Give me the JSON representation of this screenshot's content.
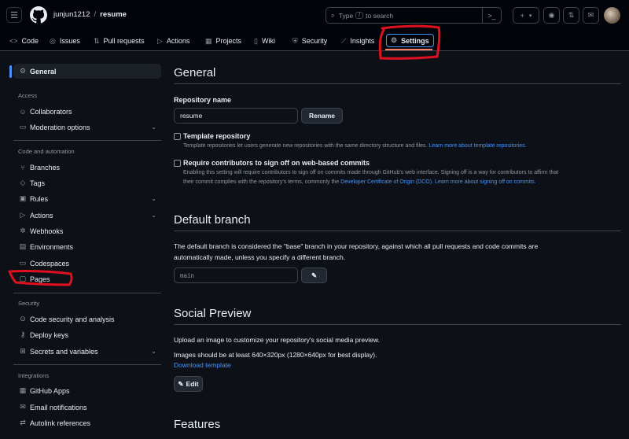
{
  "header": {
    "owner": "junjun1212",
    "separator": "/",
    "repo": "resume",
    "search_prefix": "Type",
    "search_key": "/",
    "search_suffix": "to search",
    "plus_label": "+",
    "icons": [
      "menu-icon",
      "github-logo",
      "search-icon",
      "command-palette-icon",
      "plus-icon",
      "issues-icon",
      "pull-requests-icon",
      "inbox-icon",
      "avatar"
    ]
  },
  "tabs": [
    {
      "label": "Code",
      "icon": "<>"
    },
    {
      "label": "Issues",
      "icon": "◎"
    },
    {
      "label": "Pull requests",
      "icon": "⇅"
    },
    {
      "label": "Actions",
      "icon": "▷"
    },
    {
      "label": "Projects",
      "icon": "▦"
    },
    {
      "label": "Wiki",
      "icon": "📖"
    },
    {
      "label": "Security",
      "icon": "⛨"
    },
    {
      "label": "Insights",
      "icon": "⟋"
    },
    {
      "label": "Settings",
      "icon": "⚙"
    }
  ],
  "sidebar": {
    "general": "General",
    "access_heading": "Access",
    "collaborators": "Collaborators",
    "moderation": "Moderation options",
    "code_heading": "Code and automation",
    "branches": "Branches",
    "tags": "Tags",
    "rules": "Rules",
    "actions": "Actions",
    "webhooks": "Webhooks",
    "environments": "Environments",
    "codespaces": "Codespaces",
    "pages": "Pages",
    "security_heading": "Security",
    "code_security": "Code security and analysis",
    "deploy_keys": "Deploy keys",
    "secrets": "Secrets and variables",
    "integrations_heading": "Integrations",
    "github_apps": "GitHub Apps",
    "email_notifications": "Email notifications",
    "autolink": "Autolink references"
  },
  "general": {
    "title": "General",
    "repo_name_label": "Repository name",
    "repo_name_value": "resume",
    "rename_button": "Rename",
    "template_label": "Template repository",
    "template_note": "Template repositories let users generate new repositories with the same directory structure and files.",
    "template_link": "Learn more about template repositories.",
    "signoff_label": "Require contributors to sign off on web-based commits",
    "signoff_note": "Enabling this setting will require contributors to sign off on commits made through GitHub's web interface. Signing off is a way for contributors to affirm that their commit complies with the repository's terms, commonly the",
    "signoff_link1": "Developer Certificate of Origin (DCO).",
    "signoff_link2": "Learn more about signing off on commits."
  },
  "default_branch": {
    "title": "Default branch",
    "description": "The default branch is considered the \"base\" branch in your repository, against which all pull requests and code commits are automatically made, unless you specify a different branch.",
    "branch": "main",
    "edit_icon": "pencil-icon"
  },
  "social_preview": {
    "title": "Social Preview",
    "description": "Upload an image to customize your repository's social media preview.",
    "size_note": "Images should be at least 640×320px (1280×640px for best display).",
    "download_link": "Download template",
    "edit_button": "Edit",
    "edit_icon": "pencil-icon"
  },
  "features": {
    "title": "Features"
  },
  "colors": {
    "background": "#0d1117",
    "header": "#010409",
    "accent": "#4493f8",
    "annotation": "#e0101e"
  }
}
